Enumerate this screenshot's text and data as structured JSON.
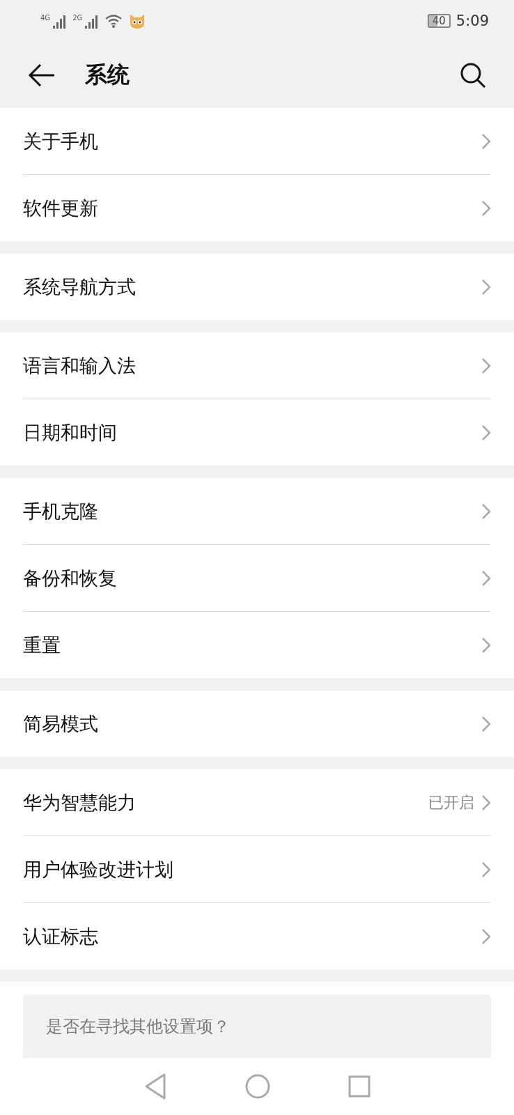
{
  "status_bar": {
    "network_1": "4G",
    "network_2": "2G",
    "battery": "40",
    "time": "5:09"
  },
  "header": {
    "title": "系统"
  },
  "groups": [
    [
      {
        "label": "关于手机"
      },
      {
        "label": "软件更新"
      }
    ],
    [
      {
        "label": "系统导航方式"
      }
    ],
    [
      {
        "label": "语言和输入法"
      },
      {
        "label": "日期和时间"
      }
    ],
    [
      {
        "label": "手机克隆"
      },
      {
        "label": "备份和恢复"
      },
      {
        "label": "重置"
      }
    ],
    [
      {
        "label": "简易模式"
      }
    ],
    [
      {
        "label": "华为智慧能力",
        "value": "已开启"
      },
      {
        "label": "用户体验改进计划"
      },
      {
        "label": "认证标志"
      }
    ]
  ],
  "suggestion_card": {
    "text": "是否在寻找其他设置项？"
  }
}
